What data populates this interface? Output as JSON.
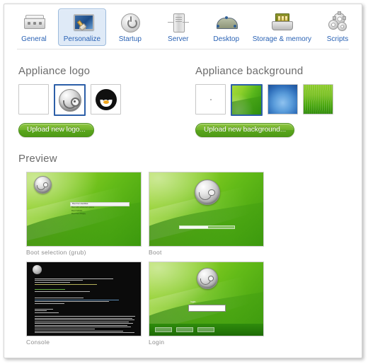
{
  "toolbar": {
    "items": [
      {
        "label": "General",
        "icon": "card-reader-icon",
        "selected": false
      },
      {
        "label": "Personalize",
        "icon": "monitor-brush-icon",
        "selected": true
      },
      {
        "label": "Startup",
        "icon": "power-icon",
        "selected": false
      },
      {
        "label": "Server",
        "icon": "server-tower-icon",
        "selected": false
      },
      {
        "label": "Desktop",
        "icon": "desktop-dome-icon",
        "selected": false
      },
      {
        "label": "Storage & memory",
        "icon": "hard-drive-memory-icon",
        "selected": false
      },
      {
        "label": "Scripts",
        "icon": "gears-icon",
        "selected": false
      }
    ]
  },
  "logo_section": {
    "title": "Appliance logo",
    "upload_label": "Upload new logo...",
    "options": [
      {
        "name": "none",
        "icon": "empty-swatch",
        "selected": false
      },
      {
        "name": "geeko",
        "icon": "opensuse-geeko-icon",
        "selected": true
      },
      {
        "name": "tux",
        "icon": "tux-penguin-icon",
        "selected": false
      }
    ]
  },
  "background_section": {
    "title": "Appliance background",
    "upload_label": "Upload new background...",
    "options": [
      {
        "name": "none",
        "icon": "empty-swatch",
        "selected": false
      },
      {
        "name": "green-swoosh",
        "icon": "green-gradient",
        "selected": true,
        "color": "#7ec423"
      },
      {
        "name": "blue-radial",
        "icon": "blue-gradient",
        "selected": false,
        "color": "#3d7fc4"
      },
      {
        "name": "green-rays",
        "icon": "green-striped",
        "selected": false,
        "color": "#66b81a"
      }
    ]
  },
  "preview_section": {
    "title": "Preview",
    "items": [
      {
        "label": "Boot selection (grub)",
        "kind": "grub",
        "menu": [
          {
            "text": "Boot from Harddisk",
            "selected": true
          },
          {
            "text": "Boot with advanced options",
            "selected": false
          },
          {
            "text": "Boot Failsafe",
            "selected": false
          },
          {
            "text": "Boot from Floppy",
            "selected": false
          }
        ]
      },
      {
        "label": "Boot",
        "kind": "boot",
        "progress": 52
      },
      {
        "label": "Console",
        "kind": "console"
      },
      {
        "label": "Login",
        "kind": "login",
        "prompt": "login:",
        "value": "",
        "buttons": [
          "Reboot",
          "Language",
          "Shutdown"
        ]
      }
    ]
  },
  "colors": {
    "accent_blue": "#2a62b4",
    "selection_blue": "#2c5fa8",
    "button_green": "#6fb22a",
    "heading_gray": "#6b6b6b"
  }
}
